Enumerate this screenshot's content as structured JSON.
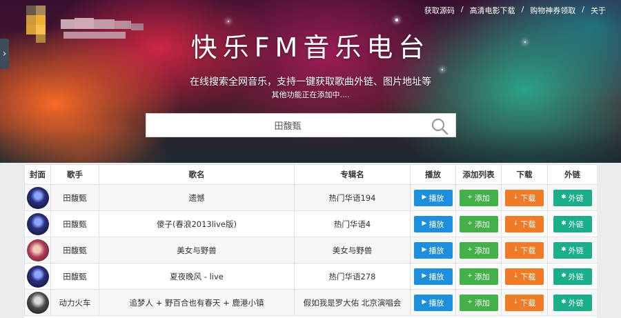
{
  "top_links": [
    "获取源码",
    "高清电影下载",
    "购物神券领取",
    "关于"
  ],
  "separator": "/",
  "side_arrow": "›",
  "site": {
    "title": "快乐FM音乐电台",
    "subtitle": "在线搜索全网音乐，支持一键获取歌曲外链、图片地址等",
    "subtitle2": "其他功能正在添加中...."
  },
  "search": {
    "value": "田馥甄"
  },
  "table": {
    "headers": [
      "封面",
      "歌手",
      "歌名",
      "专辑名",
      "播放",
      "添加列表",
      "下载",
      "外链"
    ],
    "buttons": {
      "play": "播放",
      "add": "添加",
      "download": "下载",
      "link": "外链"
    },
    "button_icons": {
      "play": "▶",
      "add": "+",
      "download": "↓",
      "link": "✱"
    },
    "rows": [
      {
        "cover": "c-blue",
        "artist": "田馥甄",
        "song": "遗憾",
        "album": "热门华语194"
      },
      {
        "cover": "c-blue",
        "artist": "田馥甄",
        "song": "傻子(春浪2013live版)",
        "album": "热门华语4"
      },
      {
        "cover": "c-red",
        "artist": "田馥甄",
        "song": "美女与野兽",
        "album": "美女与野兽"
      },
      {
        "cover": "c-blue",
        "artist": "田馥甄",
        "song": "夏夜晚风 - live",
        "album": "热门华语278"
      },
      {
        "cover": "c-dark",
        "artist": "动力火车",
        "song": "追梦人 + 野百合也有春天 + 鹿港小镇",
        "album": "假如我是罗大佑 北京演唱会"
      }
    ]
  },
  "colors": {
    "play": "#1e8fdd",
    "add": "#43b049",
    "download": "#f07a26",
    "link": "#1aae8b"
  }
}
